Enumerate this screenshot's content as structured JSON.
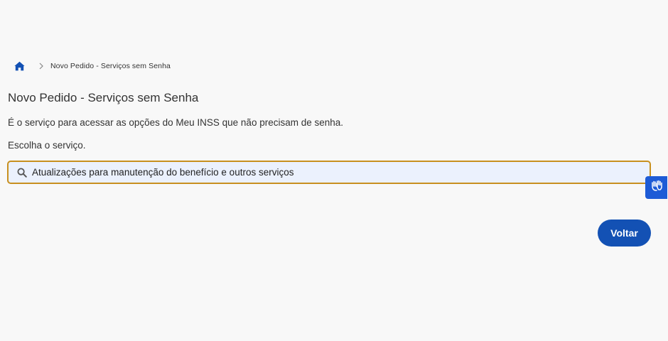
{
  "breadcrumb": {
    "home_icon": "home-icon",
    "separator_icon": "chevron-right-icon",
    "current": "Novo Pedido - Serviços sem Senha"
  },
  "page": {
    "title": "Novo Pedido - Serviços sem Senha",
    "description": "É o serviço para acessar as opções do Meu INSS que não precisam de senha.",
    "instruction": "Escolha o serviço."
  },
  "search": {
    "icon": "search-icon",
    "value": "Atualizações para manutenção do benefício e outros serviços"
  },
  "accessibility_widget": {
    "icon": "sign-language-hands-icon"
  },
  "actions": {
    "back_label": "Voltar"
  },
  "colors": {
    "primary": "#1351b4",
    "search_border": "#c8901f",
    "search_background": "#ebf1fd",
    "page_background": "#f8f8f8",
    "widget": "#1d5bd6"
  }
}
